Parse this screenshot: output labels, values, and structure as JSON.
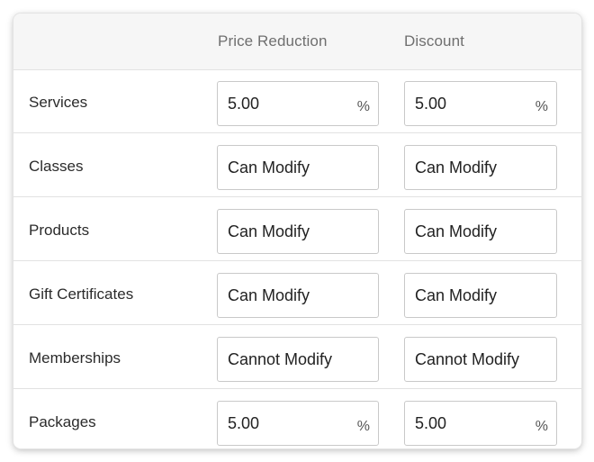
{
  "columns": {
    "price_reduction": "Price Reduction",
    "discount": "Discount"
  },
  "rows": [
    {
      "label": "Services",
      "price_reduction": "5.00",
      "price_reduction_unit": "%",
      "discount": "5.00",
      "discount_unit": "%"
    },
    {
      "label": "Classes",
      "price_reduction": "Can Modify",
      "discount": "Can Modify"
    },
    {
      "label": "Products",
      "price_reduction": "Can Modify",
      "discount": "Can Modify"
    },
    {
      "label": "Gift Certificates",
      "price_reduction": "Can Modify",
      "discount": "Can Modify"
    },
    {
      "label": "Memberships",
      "price_reduction": "Cannot Modify",
      "discount": "Cannot Modify"
    },
    {
      "label": "Packages",
      "price_reduction": "5.00",
      "price_reduction_unit": "%",
      "discount": "5.00",
      "discount_unit": "%"
    }
  ]
}
